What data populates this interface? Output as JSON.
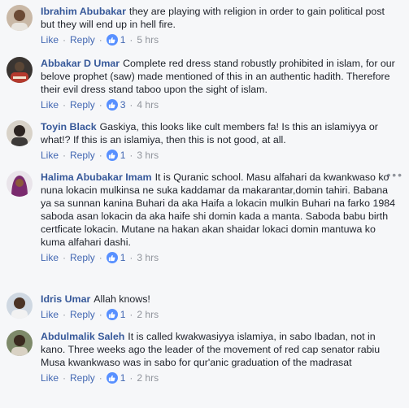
{
  "labels": {
    "like": "Like",
    "reply": "Reply",
    "sep": "·"
  },
  "comments": [
    {
      "author": "Ibrahim Abubakar",
      "text": "they are playing with religion in order to gain political post but they will end up in hell fire.",
      "reactions": "1",
      "time": "5 hrs"
    },
    {
      "author": "Abbakar D Umar",
      "text": "Complete red dress stand robustly prohibited in islam, for our belove prophet (saw) made mentioned of this in an authentic hadith. Therefore their evil dress stand taboo upon the sight of islam.",
      "reactions": "3",
      "time": "4 hrs"
    },
    {
      "author": "Toyin Black",
      "text": "Gaskiya, this looks like cult members fa! Is this an islamiyya or what!? If this is an islamiya, then this is not good, at all.",
      "reactions": "1",
      "time": "3 hrs"
    },
    {
      "author": "Halima Abubakar Imam",
      "text": "It is Quranic school. Masu alfahari da kwankwaso ko nuna lokacin mulkinsa ne suka kaddamar da makarantar,domin tahiri. Babana ya sa sunnan kanina Buhari da aka Haifa a lokacin mulkin Buhari na farko 1984 saboda asan lokacin da aka haife shi domin kada a manta. Saboda babu birth certficate lokacin. Mutane na hakan akan shaidar lokaci domin mantuwa ko kuma alfahari dashi.",
      "reactions": "1",
      "time": "3 hrs"
    },
    {
      "author": "Idris Umar",
      "text": "Allah knows!",
      "reactions": "1",
      "time": "2 hrs"
    },
    {
      "author": "Abdulmalik Saleh",
      "text": "It is called kwakwasiyya islamiya, in sabo Ibadan, not in kano. Three weeks ago the leader of the movement of red cap senator rabiu Musa kwankwaso was in sabo for qur'anic graduation of the madrasat",
      "reactions": "1",
      "time": "2 hrs"
    }
  ],
  "colors": {
    "link": "#365899",
    "action": "#4267b2",
    "muted": "#90949c",
    "like_badge": "#5890ff",
    "background": "#f6f7f9"
  },
  "icons": {
    "reaction": "thumbs-up-icon",
    "more": "more-options-icon"
  }
}
